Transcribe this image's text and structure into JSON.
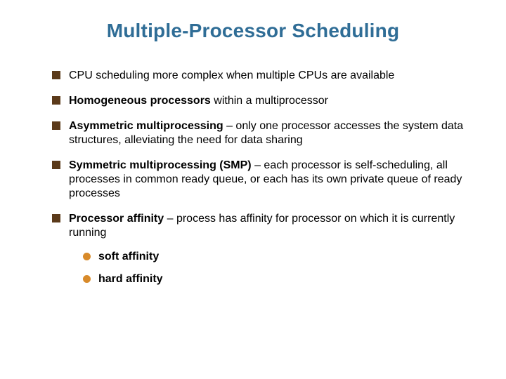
{
  "title": "Multiple-Processor Scheduling",
  "bullets": [
    {
      "prefix": "",
      "bold": "",
      "rest": "CPU scheduling more complex when multiple CPUs are available"
    },
    {
      "prefix": "",
      "bold": "Homogeneous processors",
      "rest": " within a multiprocessor"
    },
    {
      "prefix": "",
      "bold": "Asymmetric multiprocessing",
      "rest": " – only one processor accesses the system data structures, alleviating the need for data sharing"
    },
    {
      "prefix": "",
      "bold": "Symmetric multiprocessing  (SMP)",
      "rest": " – each processor is self-scheduling, all processes in common ready queue, or each has its own private queue of ready processes"
    },
    {
      "prefix": "",
      "bold": "Processor affinity",
      "rest": " – process has affinity for processor on which it is currently running"
    }
  ],
  "sub_bullets": [
    {
      "text": "soft affinity"
    },
    {
      "text": "hard affinity"
    }
  ]
}
